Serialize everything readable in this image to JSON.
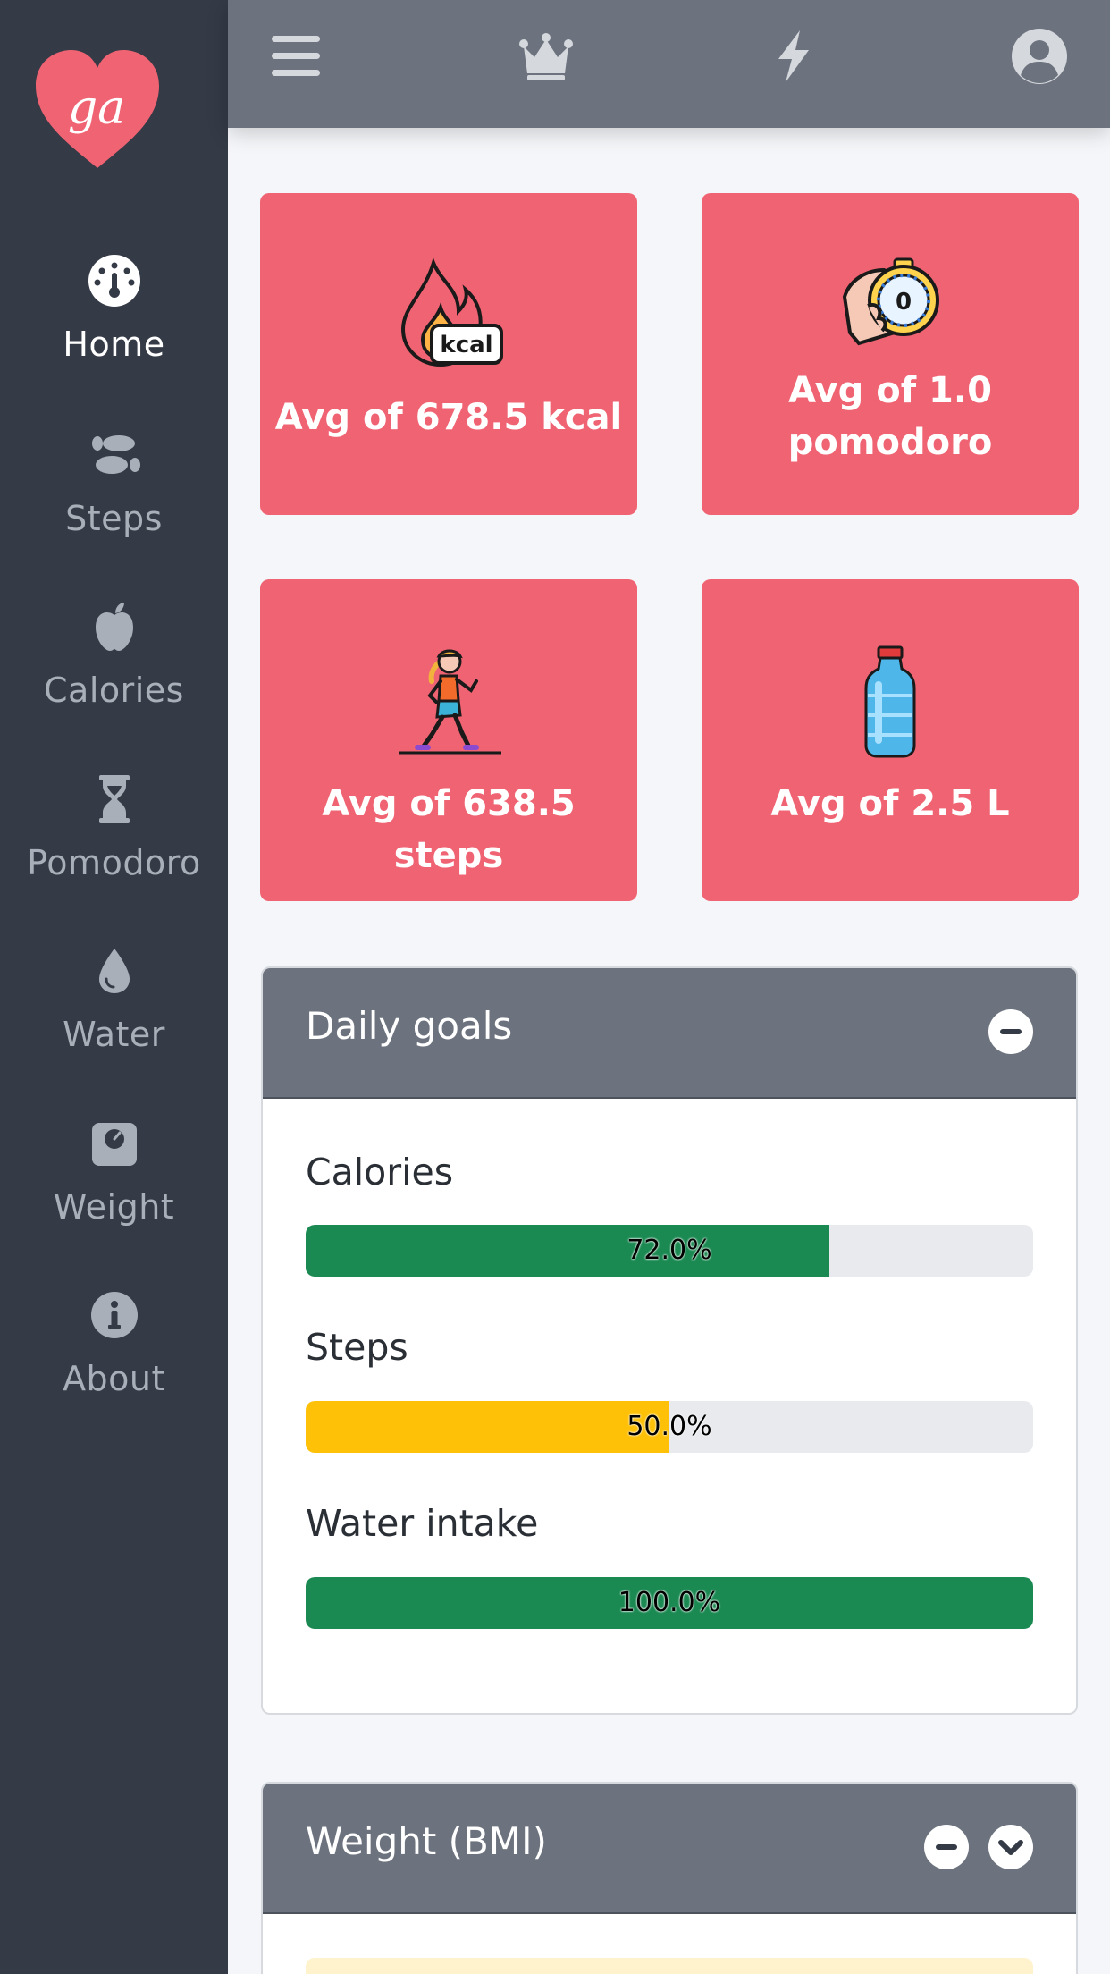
{
  "logo": {
    "text": "ga"
  },
  "sidebar": {
    "items": [
      {
        "label": "Home",
        "icon": "dashboard-gauge-icon",
        "active": true
      },
      {
        "label": "Steps",
        "icon": "footprints-icon"
      },
      {
        "label": "Calories",
        "icon": "apple-icon"
      },
      {
        "label": "Pomodoro",
        "icon": "hourglass-icon"
      },
      {
        "label": "Water",
        "icon": "water-drop-icon"
      },
      {
        "label": "Weight",
        "icon": "scale-icon"
      },
      {
        "label": "About",
        "icon": "info-icon"
      }
    ]
  },
  "topbar": {
    "icons": [
      "menu-icon",
      "crown-icon",
      "lightning-icon",
      "user-icon"
    ]
  },
  "cards": [
    {
      "text": "Avg of 678.5 kcal",
      "icon": "fire-kcal-icon",
      "badge": "kcal"
    },
    {
      "text": "Avg of 1.0 pomodoro",
      "icon": "stopwatch-hand-icon",
      "badge": "0"
    },
    {
      "text": "Avg of 638.5 steps",
      "icon": "running-woman-icon"
    },
    {
      "text": "Avg of 2.5 L",
      "icon": "water-bottle-icon"
    }
  ],
  "daily_goals": {
    "title": "Daily goals",
    "goals": [
      {
        "label": "Calories",
        "percent": 72.0,
        "text": "72.0%",
        "color": "#1b8a52"
      },
      {
        "label": "Steps",
        "percent": 50.0,
        "text": "50.0%",
        "color": "#ffc107"
      },
      {
        "label": "Water intake",
        "percent": 100.0,
        "text": "100.0%",
        "color": "#1b8a52"
      }
    ]
  },
  "weight_panel": {
    "title": "Weight (BMI)"
  },
  "colors": {
    "sidebar": "#343a46",
    "topbar": "#6c737e",
    "card": "#ef6372",
    "success": "#1b8a52",
    "warning": "#ffc107"
  }
}
